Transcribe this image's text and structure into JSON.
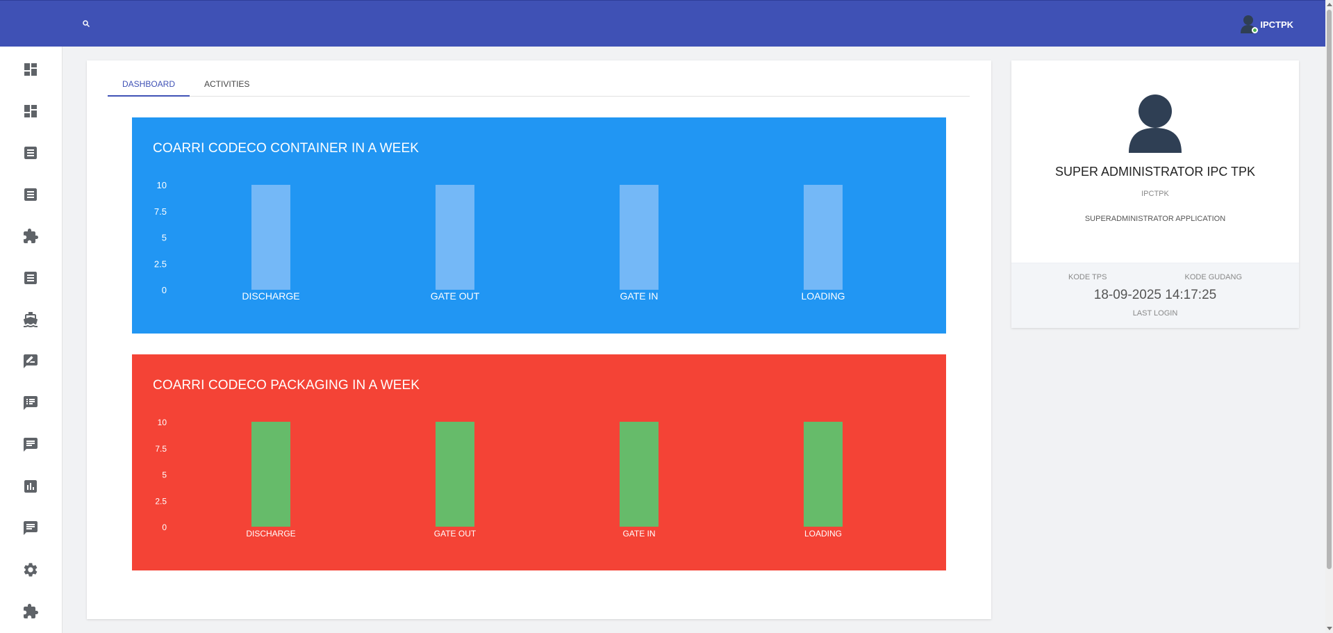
{
  "topbar": {
    "background": "#3f51b5",
    "search_icon": "search-icon",
    "username": "IPCTPK",
    "status_color": "#4caf50"
  },
  "sidebar": {
    "items": [
      {
        "icon": "dashboard-icon"
      },
      {
        "icon": "dashboard-icon"
      },
      {
        "icon": "list-alt-icon"
      },
      {
        "icon": "list-alt-icon"
      },
      {
        "icon": "puzzle-icon"
      },
      {
        "icon": "list-alt-icon"
      },
      {
        "icon": "ship-icon"
      },
      {
        "icon": "rate-review-icon"
      },
      {
        "icon": "chat-list-icon"
      },
      {
        "icon": "chat-icon"
      },
      {
        "icon": "bar-chart-icon"
      },
      {
        "icon": "chat-icon"
      },
      {
        "icon": "settings-icon"
      },
      {
        "icon": "puzzle-icon"
      }
    ]
  },
  "tabs": [
    {
      "label": "DASHBOARD",
      "active": true
    },
    {
      "label": "ACTIVITIES",
      "active": false
    }
  ],
  "chart_data": [
    {
      "type": "bar",
      "title": "COARRI CODECO CONTAINER IN A WEEK",
      "categories": [
        "DISCHARGE",
        "GATE OUT",
        "GATE IN",
        "LOADING"
      ],
      "values": [
        10,
        10,
        10,
        10
      ],
      "ylim": [
        0,
        10
      ],
      "yticks": [
        "0",
        "2.5",
        "5",
        "7.5",
        "10"
      ],
      "background": "#2196f3",
      "bar_color": "#74b8f7",
      "grid": false
    },
    {
      "type": "bar",
      "title": "COARRI CODECO PACKAGING IN A WEEK",
      "categories": [
        "DISCHARGE",
        "GATE OUT",
        "GATE IN",
        "LOADING"
      ],
      "values": [
        10,
        10,
        10,
        10
      ],
      "ylim": [
        0,
        10
      ],
      "yticks": [
        "0",
        "2.5",
        "5",
        "7.5",
        "10"
      ],
      "background": "#f44336",
      "bar_color": "#66bb6a",
      "grid": false
    }
  ],
  "profile": {
    "avatar_icon": "user-avatar-icon",
    "name": "SUPER ADMINISTRATOR IPC TPK",
    "org": "IPCTPK",
    "role": "SUPERADMINISTRATOR APPLICATION",
    "kode_tps_label": "KODE TPS",
    "kode_gudang_label": "KODE GUDANG",
    "last_login_value": "18-09-2025 14:17:25",
    "last_login_label": "LAST LOGIN"
  }
}
